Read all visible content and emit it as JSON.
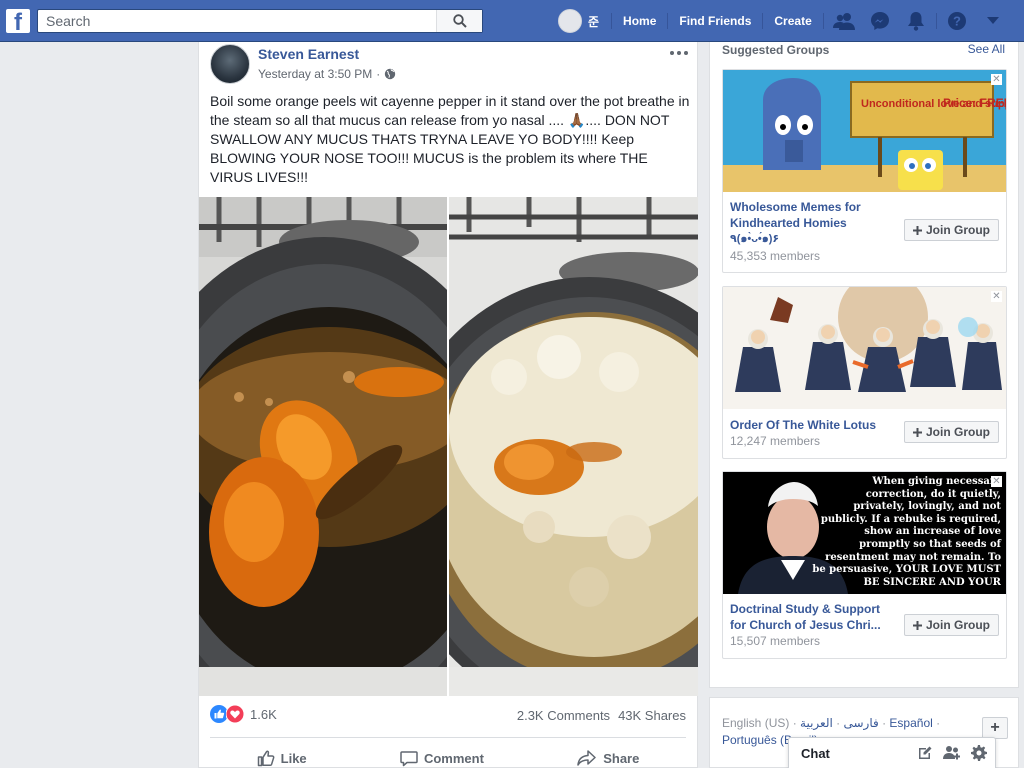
{
  "app": "Facebook",
  "topbar": {
    "logo_letter": "f",
    "search_placeholder": "Search",
    "user_name": "준",
    "nav_links": [
      "Home",
      "Find Friends",
      "Create"
    ],
    "icons": [
      "friends-icon",
      "messenger-icon",
      "notifications-icon",
      "help-icon",
      "dropdown-icon"
    ],
    "brand_color": "#4267b2"
  },
  "post": {
    "author": "Steven Earnest",
    "timestamp": "Yesterday at 3:50 PM",
    "privacy_separator": "·",
    "privacy_icon": "globe-icon",
    "text": "Boil some orange peels wit cayenne pepper in it stand over the pot breathe in the steam so all that mucus can release from yo nasal .... 🙏🏾.... DON NOT SWALLOW ANY MUCUS THATS TRYNA LEAVE YO BODY!!!! Keep BLOWING YOUR NOSE TOO!!! MUCUS is the problem its where THE VIRUS LIVES!!!",
    "reaction_count": "1.6K",
    "comments": "2.3K Comments",
    "shares": "43K Shares",
    "actions": {
      "like": "Like",
      "comment": "Comment",
      "share": "Share"
    }
  },
  "suggested_groups": {
    "title": "Suggested Groups",
    "see_all": "See All",
    "join_label": "Join Group",
    "groups": [
      {
        "name": "Wholesome Memes for Kindhearted Homies",
        "name_line2": "٩(๑•̀ᴗ•́๑)۶",
        "members": "45,353 members",
        "sign_text": "Unconditional love and support",
        "price_text": "Price: FREE"
      },
      {
        "name": "Order Of The White Lotus",
        "members": "12,247 members"
      },
      {
        "name": "Doctrinal Study & Support for Church of Jesus Chri...",
        "members": "15,507 members",
        "quote_lines": [
          "When giving necessary",
          "correction, do it quietly,",
          "privately, lovingly, and not",
          "publicly. If a rebuke is required,",
          "show an increase of love",
          "promptly so that seeds of",
          "resentment may not remain. To",
          "be persuasive, YOUR LOVE MUST",
          "BE SINCERE AND YOUR"
        ]
      }
    ]
  },
  "languages": {
    "current": "English (US)",
    "others": [
      "فارسی",
      "العربية",
      "Español",
      "Português (Brasil)"
    ]
  },
  "chat": {
    "label": "Chat"
  }
}
